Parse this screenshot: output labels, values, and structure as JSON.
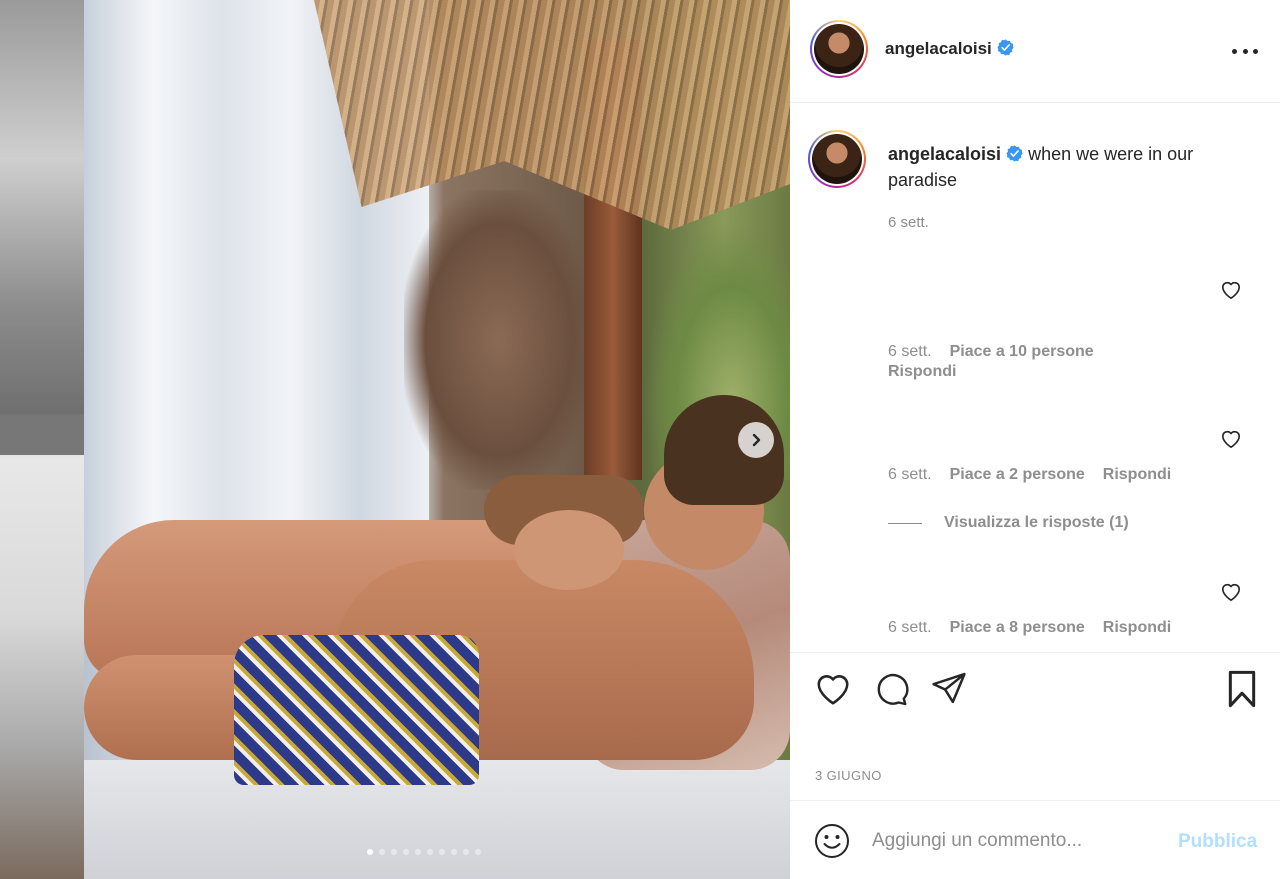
{
  "post": {
    "username": "angelacaloisi",
    "verified": true,
    "more_icon": "more-horizontal-icon",
    "caption_text": "when we were in our paradise",
    "caption_time": "6 sett.",
    "date": "3 GIUGNO",
    "media": {
      "slides_total": 10,
      "active_slide": 1,
      "next_icon": "chevron-right-icon"
    }
  },
  "comments": [
    {
      "time": "6 sett.",
      "likes": "Piace a 10 persone",
      "reply": "Rispondi"
    },
    {
      "time": "6 sett.",
      "likes": "Piace a 2 persone",
      "reply": "Rispondi",
      "view_replies": "Visualizza le risposte (1)"
    },
    {
      "time": "6 sett.",
      "likes": "Piace a 8 persone",
      "reply": "Rispondi"
    }
  ],
  "actions": {
    "like_icon": "heart-icon",
    "comment_icon": "comment-icon",
    "share_icon": "send-icon",
    "save_icon": "bookmark-icon"
  },
  "add_comment": {
    "placeholder": "Aggiungi un commento...",
    "publish_label": "Pubblica",
    "emoji_icon": "emoji-icon"
  },
  "colors": {
    "verified": "#3897f0",
    "publish_disabled": "#b2dffc",
    "muted_text": "#8e8e8e",
    "text": "#262626"
  }
}
